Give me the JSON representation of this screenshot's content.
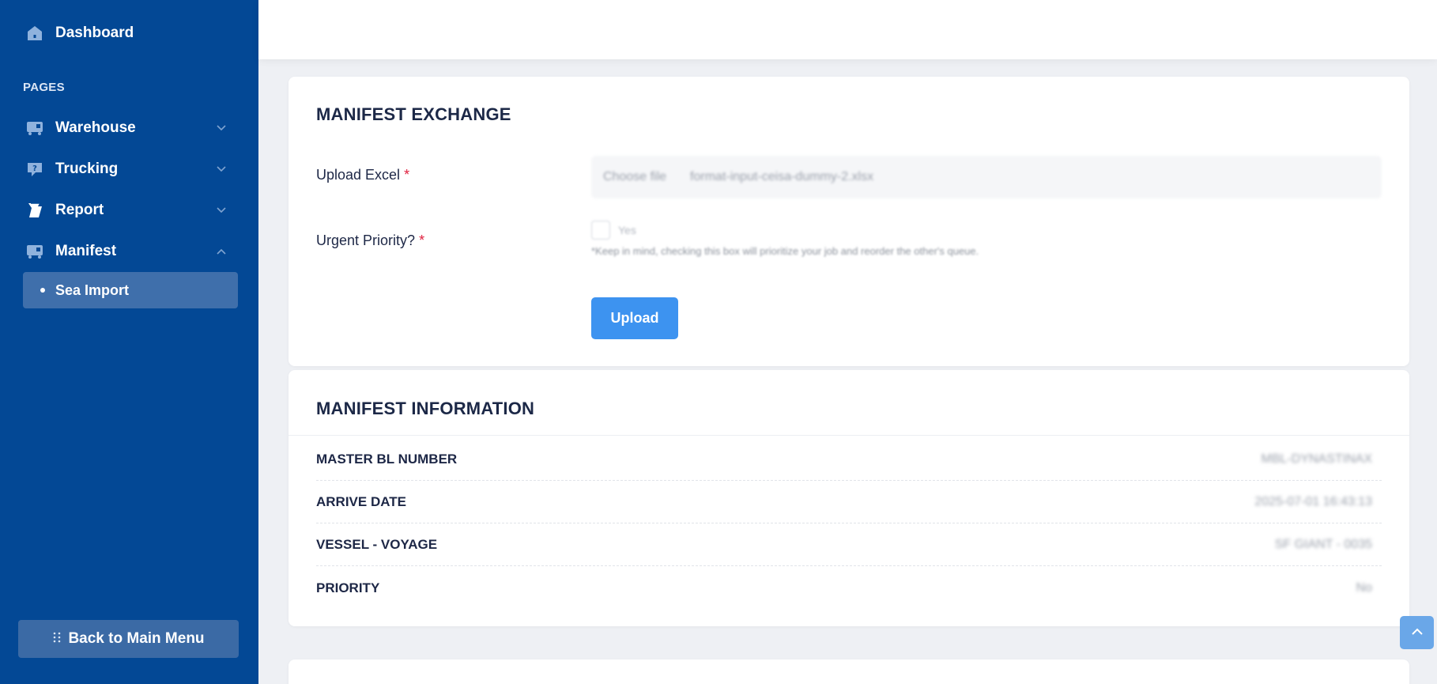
{
  "sidebar": {
    "brand": {
      "label": "Dashboard",
      "icon": "home-icon"
    },
    "section_title": "PAGES",
    "items": [
      {
        "label": "Warehouse",
        "icon": "truck-icon",
        "expanded": false
      },
      {
        "label": "Trucking",
        "icon": "question-bubble-icon",
        "expanded": false
      },
      {
        "label": "Report",
        "icon": "scroll-icon",
        "expanded": false
      },
      {
        "label": "Manifest",
        "icon": "truck-icon",
        "expanded": true
      }
    ],
    "active_subitem": "Sea Import",
    "back_button": "Back to Main Menu"
  },
  "manifest_exchange": {
    "title": "MANIFEST EXCHANGE",
    "upload_label": "Upload Excel",
    "required_mark": "*",
    "file_choose_label": "Choose file",
    "file_name": "format-input-ceisa-dummy-2.xlsx",
    "priority_label": "Urgent Priority?",
    "checkbox_label": "Yes",
    "hint": "*Keep in mind, checking this box will prioritize your job and reorder the other's queue.",
    "upload_button": "Upload"
  },
  "manifest_information": {
    "title": "MANIFEST INFORMATION",
    "rows": [
      {
        "label": "MASTER BL NUMBER",
        "value": "MBL-DYNASTINAX"
      },
      {
        "label": "ARRIVE DATE",
        "value": "2025-07-01 16:43:13"
      },
      {
        "label": "VESSEL - VOYAGE",
        "value": "SF GIANT - 0035"
      },
      {
        "label": "PRIORITY",
        "value": "No"
      }
    ]
  },
  "colors": {
    "sidebar_bg": "#034895",
    "active_bg": "#3f6fab",
    "primary_button": "#3d93f0",
    "required": "#e0213f"
  }
}
